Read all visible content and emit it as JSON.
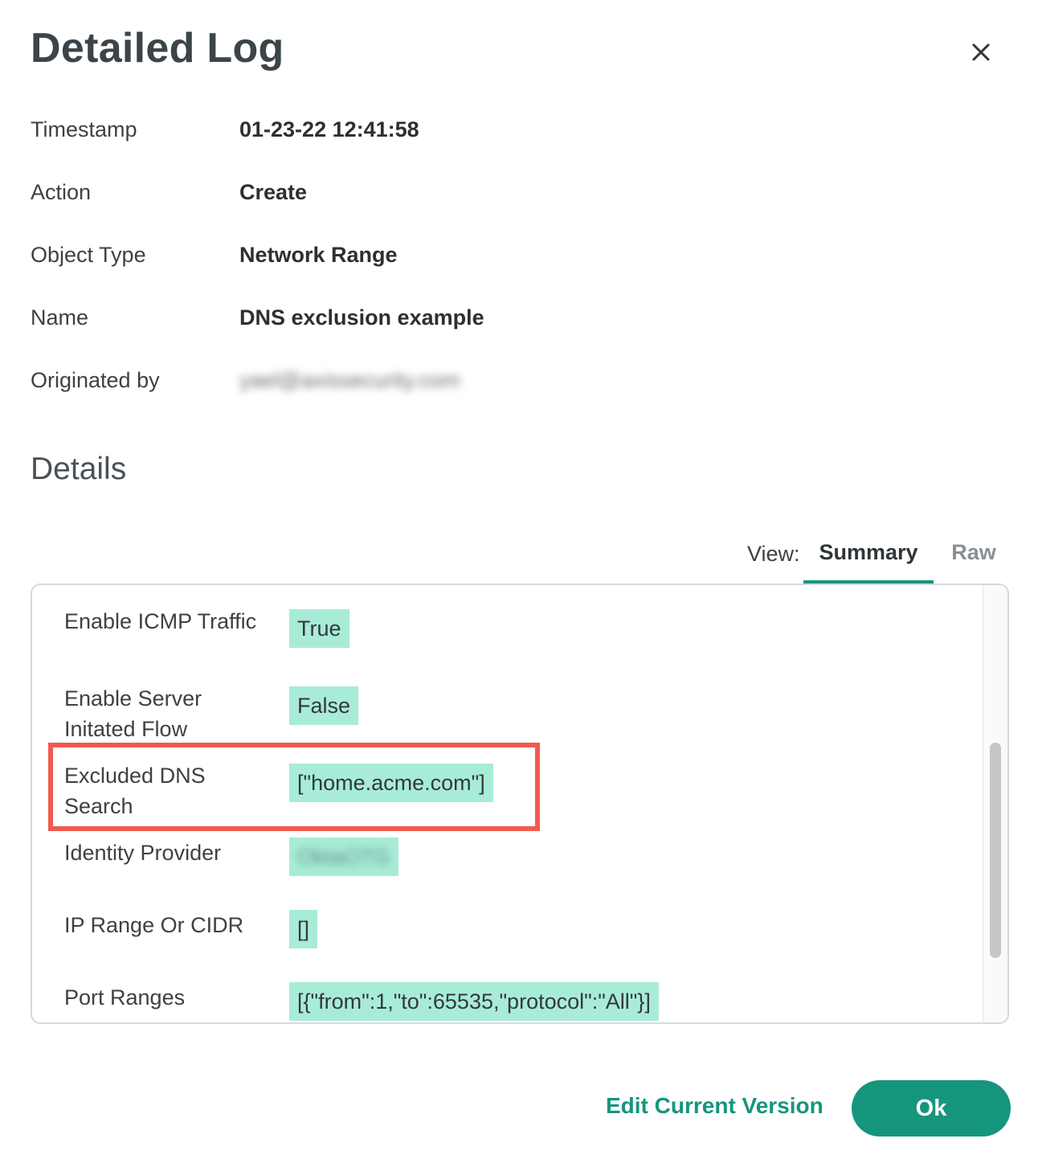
{
  "header": {
    "title": "Detailed Log",
    "close_icon": "close-icon"
  },
  "meta": [
    {
      "label": "Timestamp",
      "value": "01-23-22 12:41:58"
    },
    {
      "label": "Action",
      "value": "Create"
    },
    {
      "label": "Object Type",
      "value": "Network Range"
    },
    {
      "label": "Name",
      "value": "DNS exclusion example"
    },
    {
      "label": "Originated by",
      "value": "yael@axissecurity.com"
    }
  ],
  "details": {
    "title": "Details",
    "view_label": "View:",
    "tabs": [
      {
        "label": "Summary",
        "active": true
      },
      {
        "label": "Raw",
        "active": false
      }
    ],
    "rows": [
      {
        "label": "Enable ICMP Traffic",
        "value": "True"
      },
      {
        "label": "Enable Server Initated Flow",
        "value": "False"
      },
      {
        "label": "Excluded DNS Search",
        "value": "[\"home.acme.com\"]"
      },
      {
        "label": "Identity Provider",
        "value": "OktaOTG"
      },
      {
        "label": "IP Range Or CIDR",
        "value": "[]"
      },
      {
        "label": "Port Ranges",
        "value": "[{\"from\":1,\"to\":65535,\"protocol\":\"All\"}]"
      }
    ],
    "highlight_color": "#f25a4c",
    "chip_color": "#a8ecd8"
  },
  "footer": {
    "edit_label": "Edit Current Version",
    "ok_label": "Ok",
    "accent": "#16957d"
  }
}
